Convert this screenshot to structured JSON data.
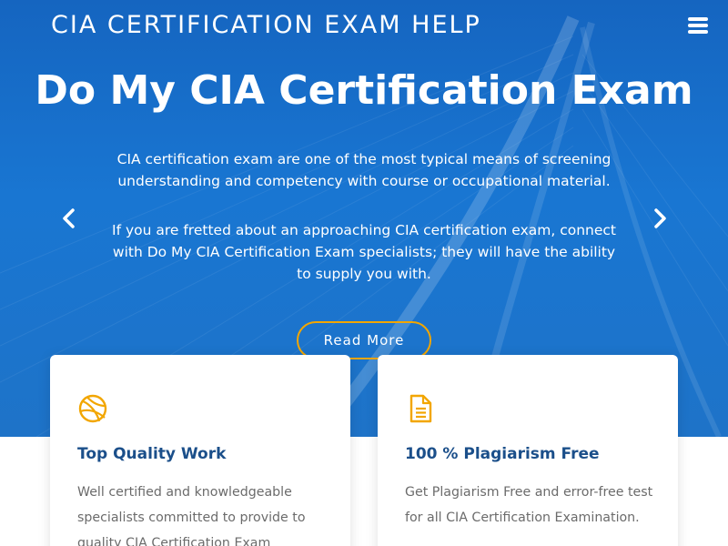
{
  "header": {
    "brand": "CIA CERTIFICATION EXAM HELP",
    "menu_icon": "hamburger-menu-icon"
  },
  "hero": {
    "title": "Do My CIA Certification Exam",
    "paragraph1": "CIA certification exam are one of the most typical means of screening understanding and competency with course or occupational material.",
    "paragraph2": "If you are fretted about an approaching CIA certification exam, connect with Do My CIA Certification Exam specialists; they will have the ability to supply you with.",
    "button_label": "Read More",
    "prev_icon": "chevron-left-icon",
    "next_icon": "chevron-right-icon"
  },
  "features": [
    {
      "icon": "dribbble-ball-icon",
      "title": "Top Quality Work",
      "text": "Well certified and knowledgeable specialists committed to provide to quality CIA Certification Exam"
    },
    {
      "icon": "document-icon",
      "title": "100 % Plagiarism Free",
      "text": "Get Plagiarism Free and error-free test for all CIA Certification Examination."
    }
  ],
  "colors": {
    "hero_blue": "#1976d2",
    "accent_orange": "#f2a600",
    "card_title": "#1b4f8a",
    "card_text": "#6b6b6b"
  }
}
